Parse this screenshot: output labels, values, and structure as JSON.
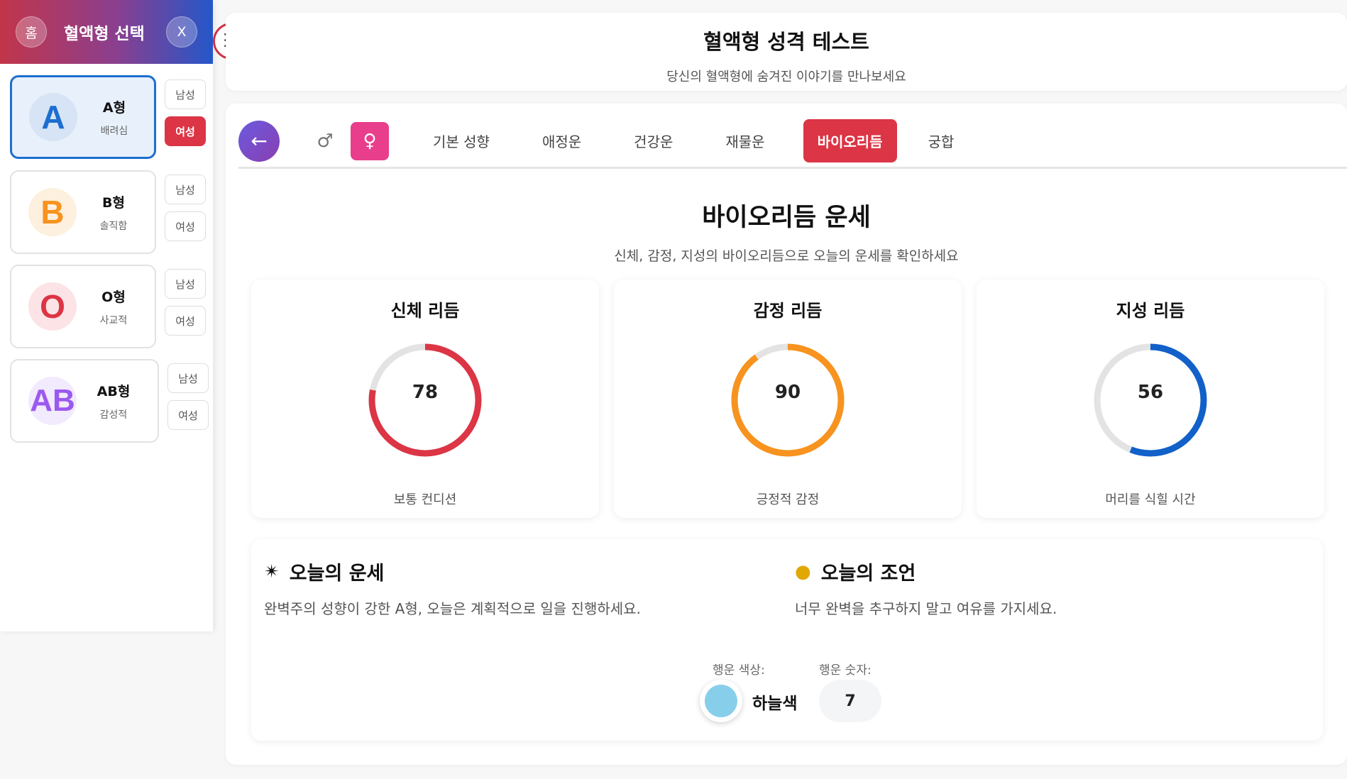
{
  "sidebar": {
    "home_label": "홈",
    "title": "혈액형 선택",
    "close_label": "X",
    "male_label": "남성",
    "female_label": "여성",
    "types": [
      {
        "letter": "A",
        "name": "A형",
        "trait": "배려심",
        "color": "#1c6ed0",
        "bg": "#dbe8f7",
        "selected": true,
        "gender": "여성"
      },
      {
        "letter": "B",
        "name": "B형",
        "trait": "솔직함",
        "color": "#f7931e",
        "bg": "#fdf0de",
        "selected": false
      },
      {
        "letter": "O",
        "name": "O형",
        "trait": "사교적",
        "color": "#dc3545",
        "bg": "#fbe3e6",
        "selected": false
      },
      {
        "letter": "AB",
        "name": "AB형",
        "trait": "감성적",
        "color": "#9b59f0",
        "bg": "#f2eafd",
        "selected": false
      }
    ]
  },
  "menu_icon": "hamburger-icon",
  "header": {
    "title": "혈액형 성격 테스트",
    "subtitle": "당신의 혈액형에 숨겨진 이야기를 만나보세요"
  },
  "tabs": {
    "back_icon": "arrow-left-icon",
    "male_symbol": "♂",
    "female_symbol": "♀",
    "items": [
      "기본 성향",
      "애정운",
      "건강운",
      "재물운",
      "바이오리듬",
      "궁합"
    ],
    "active": "바이오리듬"
  },
  "biorhythm": {
    "title": "바이오리듬 운세",
    "subtitle": "신체, 감정, 지성의 바이오리듬으로 오늘의 운세를 확인하세요",
    "cards": [
      {
        "title": "신체 리듬",
        "value": 78,
        "desc": "보통 컨디션",
        "color": "#dc3545"
      },
      {
        "title": "감정 리듬",
        "value": 90,
        "desc": "긍정적 감정",
        "color": "#f7931e"
      },
      {
        "title": "지성 리듬",
        "value": 56,
        "desc": "머리를 식힐 시간",
        "color": "#1260c9"
      }
    ]
  },
  "fortune": {
    "today_title": "오늘의 운세",
    "today_icon": "sparkle-icon",
    "today_text": "완벽주의 성향이 강한 A형, 오늘은 계획적으로 일을 진행하세요.",
    "advice_title": "오늘의 조언",
    "advice_icon": "lightbulb-icon",
    "advice_text": "너무 완벽을 추구하지 말고 여유를 가지세요.",
    "lucky_color_label": "행운 색상:",
    "lucky_color": "하늘색",
    "lucky_color_hex": "#87ceeb",
    "lucky_number_label": "행운 숫자:",
    "lucky_number": "7"
  }
}
